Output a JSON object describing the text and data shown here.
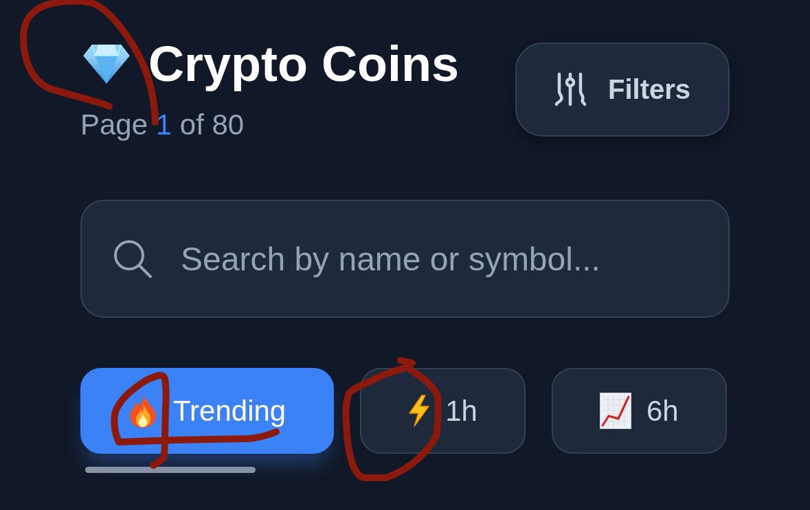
{
  "header": {
    "title": "Crypto Coins",
    "page_indicator": {
      "prefix": "Page",
      "current": "1",
      "suffix": "of 80"
    }
  },
  "filters_button": {
    "label": "Filters"
  },
  "search": {
    "placeholder": "Search by name or symbol..."
  },
  "tabs": [
    {
      "label": "Trending",
      "selected": true
    },
    {
      "label": "1h",
      "selected": false
    },
    {
      "label": "6h",
      "selected": false
    }
  ]
}
